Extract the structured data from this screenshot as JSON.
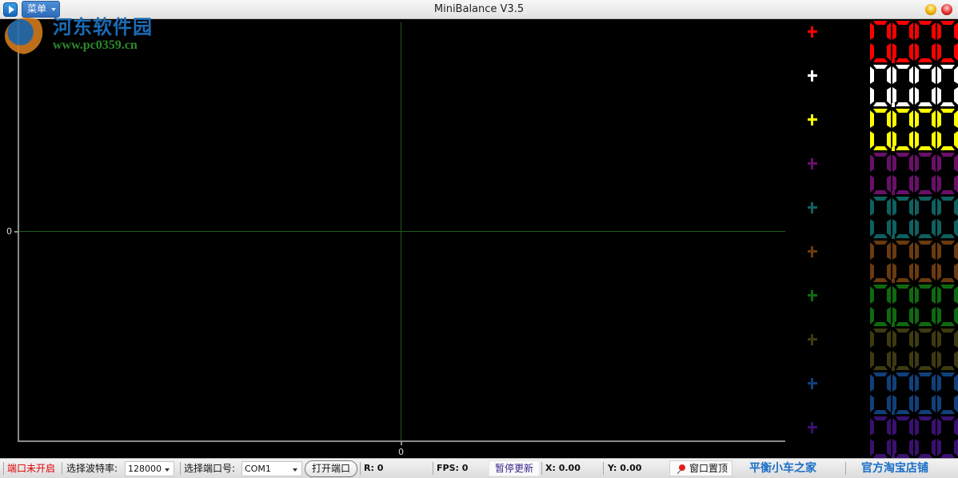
{
  "window": {
    "title": "MiniBalance V3.5",
    "menu_label": "菜单",
    "icons": {
      "app": "play-icon",
      "minimize": "minimize-icon",
      "close": "close-icon"
    }
  },
  "watermark": {
    "name": "河东软件园",
    "url": "www.pc0359.cn"
  },
  "plot": {
    "y_tick_label": "0",
    "x_tick_label": "0",
    "grid_color": "#1f5a1f"
  },
  "channels": [
    {
      "id": 1,
      "color": "#ff0000",
      "value": "0.000"
    },
    {
      "id": 2,
      "color": "#ffffff",
      "value": "0.000"
    },
    {
      "id": 3,
      "color": "#ffff00",
      "value": "0.000"
    },
    {
      "id": 4,
      "color": "#6a0f6a",
      "value": "0.000"
    },
    {
      "id": 5,
      "color": "#0f6060",
      "value": "0.000"
    },
    {
      "id": 6,
      "color": "#6a3a10",
      "value": "0.000"
    },
    {
      "id": 7,
      "color": "#0f6a0f",
      "value": "0.000"
    },
    {
      "id": 8,
      "color": "#3d3a10",
      "value": "0.000"
    },
    {
      "id": 9,
      "color": "#10407a",
      "value": "0.000"
    },
    {
      "id": 10,
      "color": "#3a1070",
      "value": "0.000"
    }
  ],
  "statusbar": {
    "port_status": "端口未开启",
    "baud_label": "选择波特率:",
    "baud_value": "128000",
    "port_label": "选择端口号:",
    "port_value": "COM1",
    "open_button": "打开端口",
    "r_readout": "R:  0",
    "fps_readout": "FPS:  0",
    "pause_button": "暂停更新",
    "x_readout": "X:  0.00",
    "y_readout": "Y:  0.00",
    "pin_button": "窗口置顶",
    "link_home": "平衡小车之家",
    "link_shop": "官方淘宝店铺"
  }
}
